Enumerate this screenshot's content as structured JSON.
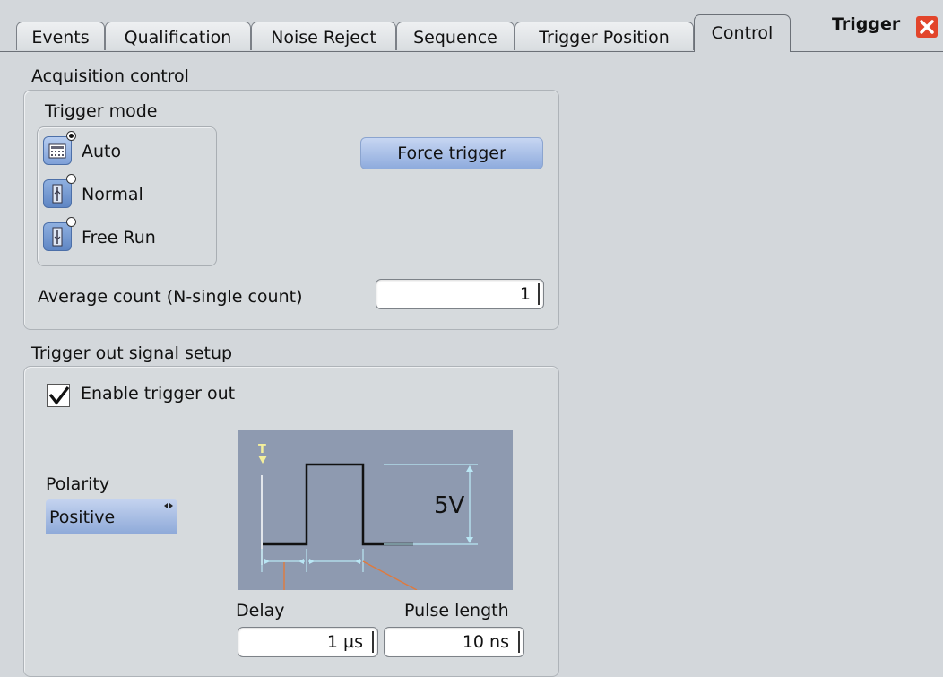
{
  "tabs": [
    {
      "label": "Events",
      "active": false
    },
    {
      "label": "Qualification",
      "active": false
    },
    {
      "label": "Noise Reject",
      "active": false
    },
    {
      "label": "Sequence",
      "active": false
    },
    {
      "label": "Trigger Position",
      "active": false
    },
    {
      "label": "Control",
      "active": true
    }
  ],
  "panel": {
    "title": "Trigger",
    "close_icon": "close-icon"
  },
  "acquisition": {
    "section_label": "Acquisition control",
    "trigger_mode": {
      "label": "Trigger mode",
      "options": [
        {
          "label": "Auto",
          "selected": true,
          "icon": "auto-mode-icon"
        },
        {
          "label": "Normal",
          "selected": false,
          "icon": "normal-mode-icon"
        },
        {
          "label": "Free Run",
          "selected": false,
          "icon": "free-run-mode-icon"
        }
      ]
    },
    "force_trigger_label": "Force trigger",
    "average_count": {
      "label": "Average count (N-single count)",
      "value": "1"
    }
  },
  "trigger_out": {
    "section_label": "Trigger out signal setup",
    "enable": {
      "label": "Enable trigger out",
      "checked": true
    },
    "polarity": {
      "label": "Polarity",
      "value": "Positive"
    },
    "diagram": {
      "amplitude_label": "5V",
      "trigger_marker": "T"
    },
    "delay": {
      "label": "Delay",
      "value": "1 µs"
    },
    "pulse_length": {
      "label": "Pulse length",
      "value": "10 ns"
    }
  },
  "colors": {
    "background": "#d3d7db",
    "accent_blue": "#8eabdd",
    "close_red": "#e2452b",
    "diagram_bg": "#8e9ab0",
    "diagram_cyan": "#b9e6f4"
  }
}
